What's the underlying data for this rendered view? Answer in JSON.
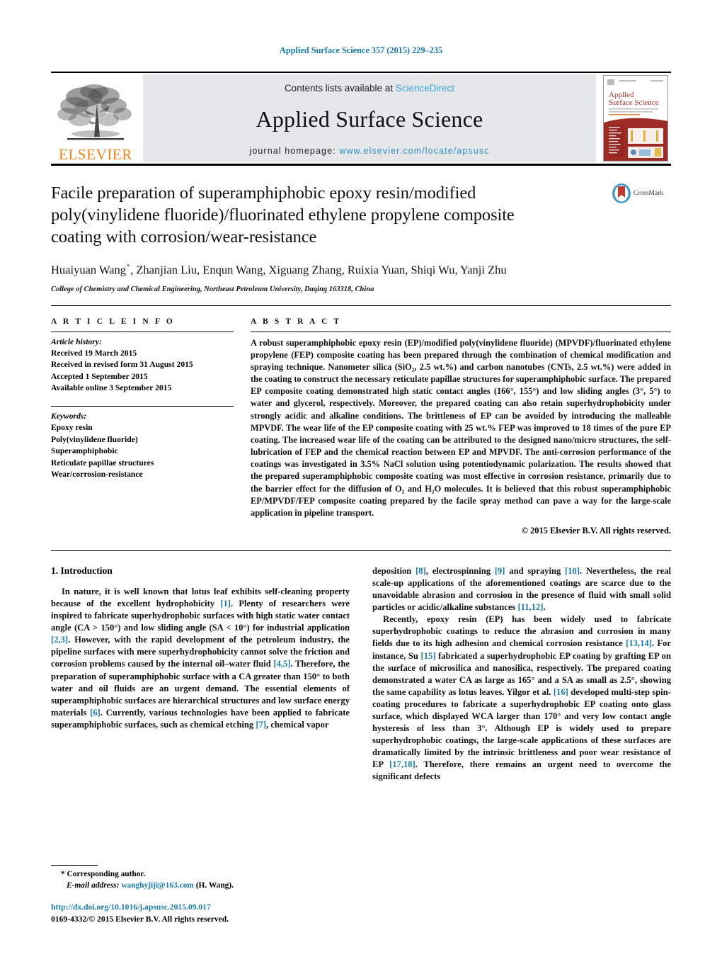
{
  "running_head": "Applied Surface Science 357 (2015) 229–235",
  "masthead": {
    "publisher_logo_text": "ELSEVIER",
    "contents_prefix": "Contents lists available at ",
    "contents_link": "ScienceDirect",
    "journal_name": "Applied Surface Science",
    "homepage_label": "journal homepage: ",
    "homepage_url": "www.elsevier.com/locate/apsusc",
    "cover_title_line1": "Applied",
    "cover_title_line2": "Surface Science"
  },
  "crossmark": {
    "label": "CrossMark"
  },
  "article": {
    "title": "Facile preparation of superamphiphobic epoxy resin/modified poly(vinylidene fluoride)/fluorinated ethylene propylene composite coating with corrosion/wear-resistance",
    "authors": "Huaiyuan Wang",
    "authors_rest": ", Zhanjian Liu, Enqun Wang, Xiguang Zhang, Ruixia Yuan, Shiqi Wu, Yanji Zhu",
    "corresponding_marker": "*",
    "affiliation": "College of Chemistry and Chemical Engineering, Northeast Petroleum University, Daqing 163318, China"
  },
  "article_info": {
    "heading": "A R T I C L E   I N F O",
    "history_label": "Article history:",
    "history": [
      "Received 19 March 2015",
      "Received in revised form 31 August 2015",
      "Accepted 1 September 2015",
      "Available online 3 September 2015"
    ],
    "keywords_label": "Keywords:",
    "keywords": [
      "Epoxy resin",
      "Poly(vinylidene fluoride)",
      "Superamphiphobic",
      "Reticulate papillae structures",
      "Wear/corrosion-resistance"
    ]
  },
  "abstract": {
    "heading": "A B S T R A C T",
    "text": "A robust superamphiphobic epoxy resin (EP)/modified poly(vinylidene fluoride) (MPVDF)/fluorinated ethylene propylene (FEP) composite coating has been prepared through the combination of chemical modification and spraying technique. Nanometer silica (SiO₂, 2.5 wt.%) and carbon nanotubes (CNTs, 2.5 wt.%) were added in the coating to construct the necessary reticulate papillae structures for superamphiphobic surface. The prepared EP composite coating demonstrated high static contact angles (166°, 155°) and low sliding angles (3°, 5°) to water and glycerol, respectively. Moreover, the prepared coating can also retain superhydrophobicity under strongly acidic and alkaline conditions. The brittleness of EP can be avoided by introducing the malleable MPVDF. The wear life of the EP composite coating with 25 wt.% FEP was improved to 18 times of the pure EP coating. The increased wear life of the coating can be attributed to the designed nano/micro structures, the self-lubrication of FEP and the chemical reaction between EP and MPVDF. The anti-corrosion performance of the coatings was investigated in 3.5% NaCl solution using potentiodynamic polarization. The results showed that the prepared superamphiphobic composite coating was most effective in corrosion resistance, primarily due to the barrier effect for the diffusion of O₂ and H₂O molecules. It is believed that this robust superamphiphobic EP/MPVDF/FEP composite coating prepared by the facile spray method can pave a way for the large-scale application in pipeline transport.",
    "copyright": "© 2015 Elsevier B.V. All rights reserved."
  },
  "body": {
    "section1_title": "1.  Introduction",
    "left_paragraph_1_part1": "In nature, it is well known that lotus leaf exhibits self-cleaning property because of the excellent hydrophobicity ",
    "ref1": "[1]",
    "left_paragraph_1_part2": ". Plenty of researchers were inspired to fabricate superhydrophobic surfaces with high static water contact angle (CA > 150°) and low sliding angle (SA < 10°) for industrial application ",
    "ref23": "[2,3]",
    "left_paragraph_1_part3": ". However, with the rapid development of the petroleum industry, the pipeline surfaces with mere superhydrophobicity cannot solve the friction and corrosion problems caused by the internal oil–water fluid ",
    "ref45": "[4,5]",
    "left_paragraph_1_part4": ". Therefore, the preparation of superamphiphobic surface with a CA greater than 150° to both water and oil fluids are an urgent demand. The essential elements of superamphiphobic surfaces are hierarchical structures and low surface energy materials ",
    "ref6": "[6]",
    "left_paragraph_1_part5": ". Currently, various technologies have been applied to fabricate superamphiphobic surfaces, such as chemical etching ",
    "ref7": "[7]",
    "left_paragraph_1_part6": ", chemical vapor",
    "right_paragraph_1_part1": "deposition ",
    "ref8": "[8]",
    "right_paragraph_1_part2": ", electrospinning ",
    "ref9": "[9]",
    "right_paragraph_1_part3": " and spraying ",
    "ref10": "[10]",
    "right_paragraph_1_part4": ". Nevertheless, the real scale-up applications of the aforementioned coatings are scarce due to the unavoidable abrasion and corrosion in the presence of fluid with small solid particles or acidic/alkaline substances ",
    "ref1112": "[11,12]",
    "right_paragraph_1_part5": ".",
    "right_paragraph_2_part1": "Recently, epoxy resin (EP) has been widely used to fabricate superhydrophobic coatings to reduce the abrasion and corrosion in many fields due to its high adhesion and chemical corrosion resistance ",
    "ref1314": "[13,14]",
    "right_paragraph_2_part2": ". For instance, Su ",
    "ref15": "[15]",
    "right_paragraph_2_part3": " fabricated a superhydrophobic EP coating by grafting EP on the surface of microsilica and nanosilica, respectively. The prepared coating demonstrated a water CA as large as 165° and a SA as small as 2.5°, showing the same capability as lotus leaves. Yilgor et al. ",
    "ref16": "[16]",
    "right_paragraph_2_part4": " developed multi-step spin-coating procedures to fabricate a superhydrophobic EP coating onto glass surface, which displayed WCA larger than 170° and very low contact angle hysteresis of less than 3°. Although EP is widely used to prepare superhydrophobic coatings, the large-scale applications of these surfaces are dramatically limited by the intrinsic brittleness and poor wear resistance of EP ",
    "ref1718": "[17,18]",
    "right_paragraph_2_part5": ". Therefore, there remains an urgent need to overcome the significant defects"
  },
  "footnote": {
    "corresponding_marker": "*",
    "corresponding_text": " Corresponding author.",
    "email_label": "E-mail address:",
    "email": "wanghyjiji@163.com",
    "email_owner": " (H. Wang)."
  },
  "footer": {
    "doi": "http://dx.doi.org/10.1016/j.apsusc.2015.09.017",
    "issn_line": "0169-4332/© 2015 Elsevier B.V. All rights reserved."
  },
  "colors": {
    "link_blue": "#1a7ba8",
    "sciencedirect_blue": "#3ba4d4",
    "elsevier_orange": "#f07f16",
    "masthead_grey": "#e6e7e8",
    "cover_red": "#9e2b25"
  }
}
